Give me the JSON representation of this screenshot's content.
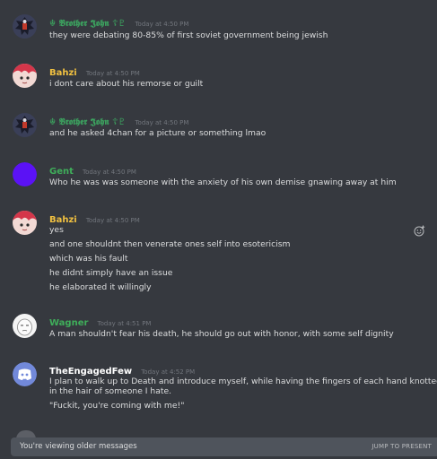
{
  "colors": {
    "background": "#36393f",
    "bottom_bar": "#4f545c",
    "user_brother_john": "#3ca25f",
    "user_bahzi": "#f0c040",
    "user_gent": "#3fae5a",
    "user_wagner": "#3fae5a",
    "user_engagedfew": "#ffffff"
  },
  "messages": [
    {
      "author": "☬ 𝕭𝖗𝖔𝖙𝖍𝖊𝖗 𝕵𝖔𝖍𝖓 ☦♇",
      "timestamp": "Today at 4:50 PM",
      "avatar_icon": "emblem-avatar",
      "lines": [
        "they were debating 80-85% of first soviet government being jewish"
      ]
    },
    {
      "author": "Bahzi",
      "timestamp": "Today at 4:50 PM",
      "avatar_icon": "anime-avatar",
      "lines": [
        "i dont care about his remorse or guilt"
      ]
    },
    {
      "author": "☬ 𝕭𝖗𝖔𝖙𝖍𝖊𝖗 𝕵𝖔𝖍𝖓 ☦♇",
      "timestamp": "Today at 4:50 PM",
      "avatar_icon": "emblem-avatar",
      "lines": [
        "and he asked 4chan for a picture or something lmao"
      ]
    },
    {
      "author": "Gent",
      "timestamp": "Today at 4:50 PM",
      "avatar_icon": "purple-circle-avatar",
      "lines": [
        "Who he was was someone with the anxiety of his own demise gnawing away at him"
      ]
    },
    {
      "author": "Bahzi",
      "timestamp": "Today at 4:50 PM",
      "avatar_icon": "anime-avatar",
      "lines": [
        "yes",
        "and one shouldnt then venerate ones self into esotericism",
        "which was his fault",
        "he didnt simply have an issue",
        "he elaborated it willingly"
      ]
    },
    {
      "author": "Wagner",
      "timestamp": "Today at 4:51 PM",
      "avatar_icon": "wojak-avatar",
      "lines": [
        "A man shouldn't fear his death, he should go out with honor, with some self dignity"
      ]
    },
    {
      "author": "TheEngagedFew",
      "timestamp": "Today at 4:52 PM",
      "avatar_icon": "discord-logo-avatar",
      "lines": [
        "I plan to walk up to Death and introduce myself, while having the fingers of each hand knotted",
        "in the hair of someone I hate.",
        "\"Fuckit, you're coming with me!\""
      ]
    }
  ],
  "bottom_bar": {
    "message": "You're viewing older messages",
    "action": "JUMP TO PRESENT"
  }
}
